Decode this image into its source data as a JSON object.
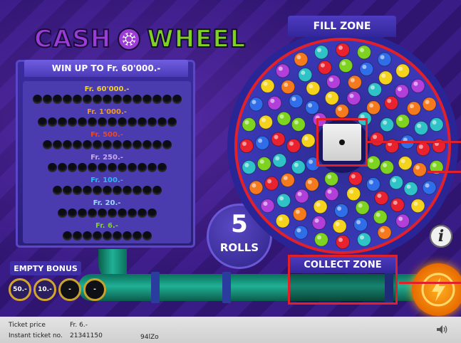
{
  "logo": {
    "word1": "CASH",
    "word2": "WHEEL"
  },
  "prize_panel": {
    "header": "WIN UP TO Fr. 60'000.-",
    "tiers": [
      {
        "amount": "Fr. 60'000.-",
        "color": "#f6d21a",
        "dots": 15
      },
      {
        "amount": "Fr. 1'000.-",
        "color": "#f39a1c",
        "dots": 14
      },
      {
        "amount": "Fr. 500.-",
        "color": "#f0461e",
        "dots": 13
      },
      {
        "amount": "Fr. 250.-",
        "color": "#c8a8ee",
        "dots": 12
      },
      {
        "amount": "Fr. 100.-",
        "color": "#2fb8f0",
        "dots": 11
      },
      {
        "amount": "Fr. 20.-",
        "color": "#9ad8ff",
        "dots": 10
      },
      {
        "amount": "Fr. 6.-",
        "color": "#7ed321",
        "dots": 9
      }
    ]
  },
  "rolls": {
    "count": "5",
    "label": "ROLLS"
  },
  "fill_zone": {
    "label": "FILL ZONE"
  },
  "collect_zone": {
    "label": "COLLECT ZONE"
  },
  "empty_bonus": {
    "label": "EMPTY BONUS",
    "slots": [
      "50.-",
      "10.-",
      "-",
      "-"
    ]
  },
  "footer": {
    "ticket_price_label": "Ticket price",
    "ticket_price": "Fr. 6.-",
    "instant_ticket_label": "Instant ticket no.",
    "instant_ticket": "21341150",
    "code": "94lZo"
  },
  "colors": {
    "ball_palette": [
      "#e8222e",
      "#f47a1d",
      "#f5d21c",
      "#7ed321",
      "#2fc3c8",
      "#b23fd9",
      "#2f6ee8"
    ],
    "highlight": "#e0202a"
  },
  "icons": {
    "info": "i",
    "sound": "sound-icon",
    "die": "die-icon",
    "collect": "lightning-icon"
  }
}
